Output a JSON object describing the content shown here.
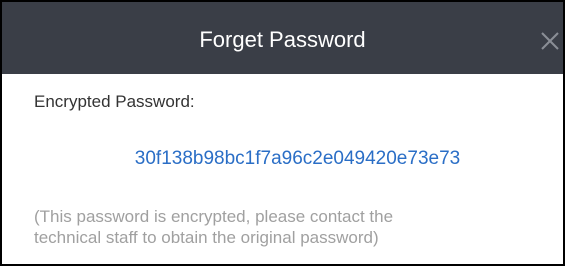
{
  "dialog": {
    "title": "Forget Password",
    "close_icon": "close-icon",
    "label": "Encrypted Password:",
    "password": "30f138b98bc1f7a96c2e049420e73e73",
    "note_line1": "(This password is encrypted, please contact the",
    "note_line2": "technical staff to obtain the original password)"
  },
  "colors": {
    "titlebar_bg": "#3a3e47",
    "title_text": "#ffffff",
    "password_text": "#2a6ec6",
    "note_text": "#a0a0a0"
  }
}
